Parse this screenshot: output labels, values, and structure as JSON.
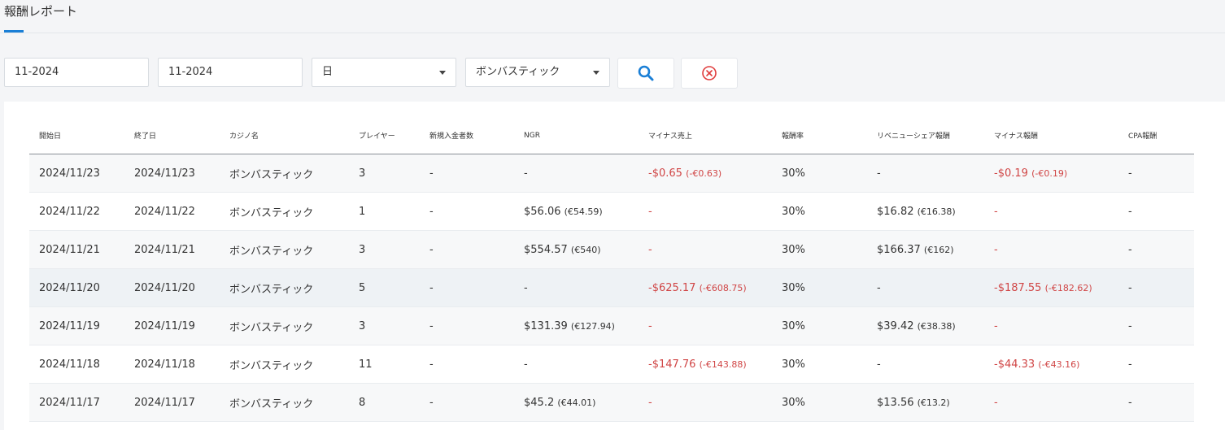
{
  "page": {
    "title": "報酬レポート"
  },
  "filters": {
    "start_month": "11-2024",
    "end_month": "11-2024",
    "period": "日",
    "casino": "ボンバスティック"
  },
  "colors": {
    "accent": "#1a7fd6",
    "negative": "#d04545",
    "clear": "#e03c3c"
  },
  "icons": {
    "search": "search-icon",
    "clear": "clear-circle-x-icon",
    "dropdown": "chevron-down-icon"
  },
  "table": {
    "columns": [
      "開始日",
      "終了日",
      "カジノ名",
      "プレイヤー",
      "新規入金者数",
      "NGR",
      "マイナス売上",
      "報酬率",
      "リベニューシェア報酬",
      "マイナス報酬",
      "CPA報酬"
    ],
    "rows": [
      {
        "start": "2024/11/23",
        "end": "2024/11/23",
        "casino": "ボンバスティック",
        "players": "3",
        "new_depositors": "-",
        "ngr": "-",
        "ngr_sub": "",
        "neg_rev": "-$0.65",
        "neg_rev_sub": "(-€0.63)",
        "rate": "30%",
        "revshare": "-",
        "revshare_sub": "",
        "neg_comm": "-$0.19",
        "neg_comm_sub": "(-€0.19)",
        "cpa": "-"
      },
      {
        "start": "2024/11/22",
        "end": "2024/11/22",
        "casino": "ボンバスティック",
        "players": "1",
        "new_depositors": "-",
        "ngr": "$56.06",
        "ngr_sub": "(€54.59)",
        "neg_rev": "-",
        "neg_rev_sub": "",
        "rate": "30%",
        "revshare": "$16.82",
        "revshare_sub": "(€16.38)",
        "neg_comm": "-",
        "neg_comm_sub": "",
        "cpa": "-"
      },
      {
        "start": "2024/11/21",
        "end": "2024/11/21",
        "casino": "ボンバスティック",
        "players": "3",
        "new_depositors": "-",
        "ngr": "$554.57",
        "ngr_sub": "(€540)",
        "neg_rev": "-",
        "neg_rev_sub": "",
        "rate": "30%",
        "revshare": "$166.37",
        "revshare_sub": "(€162)",
        "neg_comm": "-",
        "neg_comm_sub": "",
        "cpa": "-"
      },
      {
        "start": "2024/11/20",
        "end": "2024/11/20",
        "casino": "ボンバスティック",
        "players": "5",
        "new_depositors": "-",
        "ngr": "-",
        "ngr_sub": "",
        "neg_rev": "-$625.17",
        "neg_rev_sub": "(-€608.75)",
        "rate": "30%",
        "revshare": "-",
        "revshare_sub": "",
        "neg_comm": "-$187.55",
        "neg_comm_sub": "(-€182.62)",
        "cpa": "-"
      },
      {
        "start": "2024/11/19",
        "end": "2024/11/19",
        "casino": "ボンバスティック",
        "players": "3",
        "new_depositors": "-",
        "ngr": "$131.39",
        "ngr_sub": "(€127.94)",
        "neg_rev": "-",
        "neg_rev_sub": "",
        "rate": "30%",
        "revshare": "$39.42",
        "revshare_sub": "(€38.38)",
        "neg_comm": "-",
        "neg_comm_sub": "",
        "cpa": "-"
      },
      {
        "start": "2024/11/18",
        "end": "2024/11/18",
        "casino": "ボンバスティック",
        "players": "11",
        "new_depositors": "-",
        "ngr": "-",
        "ngr_sub": "",
        "neg_rev": "-$147.76",
        "neg_rev_sub": "(-€143.88)",
        "rate": "30%",
        "revshare": "-",
        "revshare_sub": "",
        "neg_comm": "-$44.33",
        "neg_comm_sub": "(-€43.16)",
        "cpa": "-"
      },
      {
        "start": "2024/11/17",
        "end": "2024/11/17",
        "casino": "ボンバスティック",
        "players": "8",
        "new_depositors": "-",
        "ngr": "$45.2",
        "ngr_sub": "(€44.01)",
        "neg_rev": "-",
        "neg_rev_sub": "",
        "rate": "30%",
        "revshare": "$13.56",
        "revshare_sub": "(€13.2)",
        "neg_comm": "-",
        "neg_comm_sub": "",
        "cpa": "-"
      }
    ]
  }
}
